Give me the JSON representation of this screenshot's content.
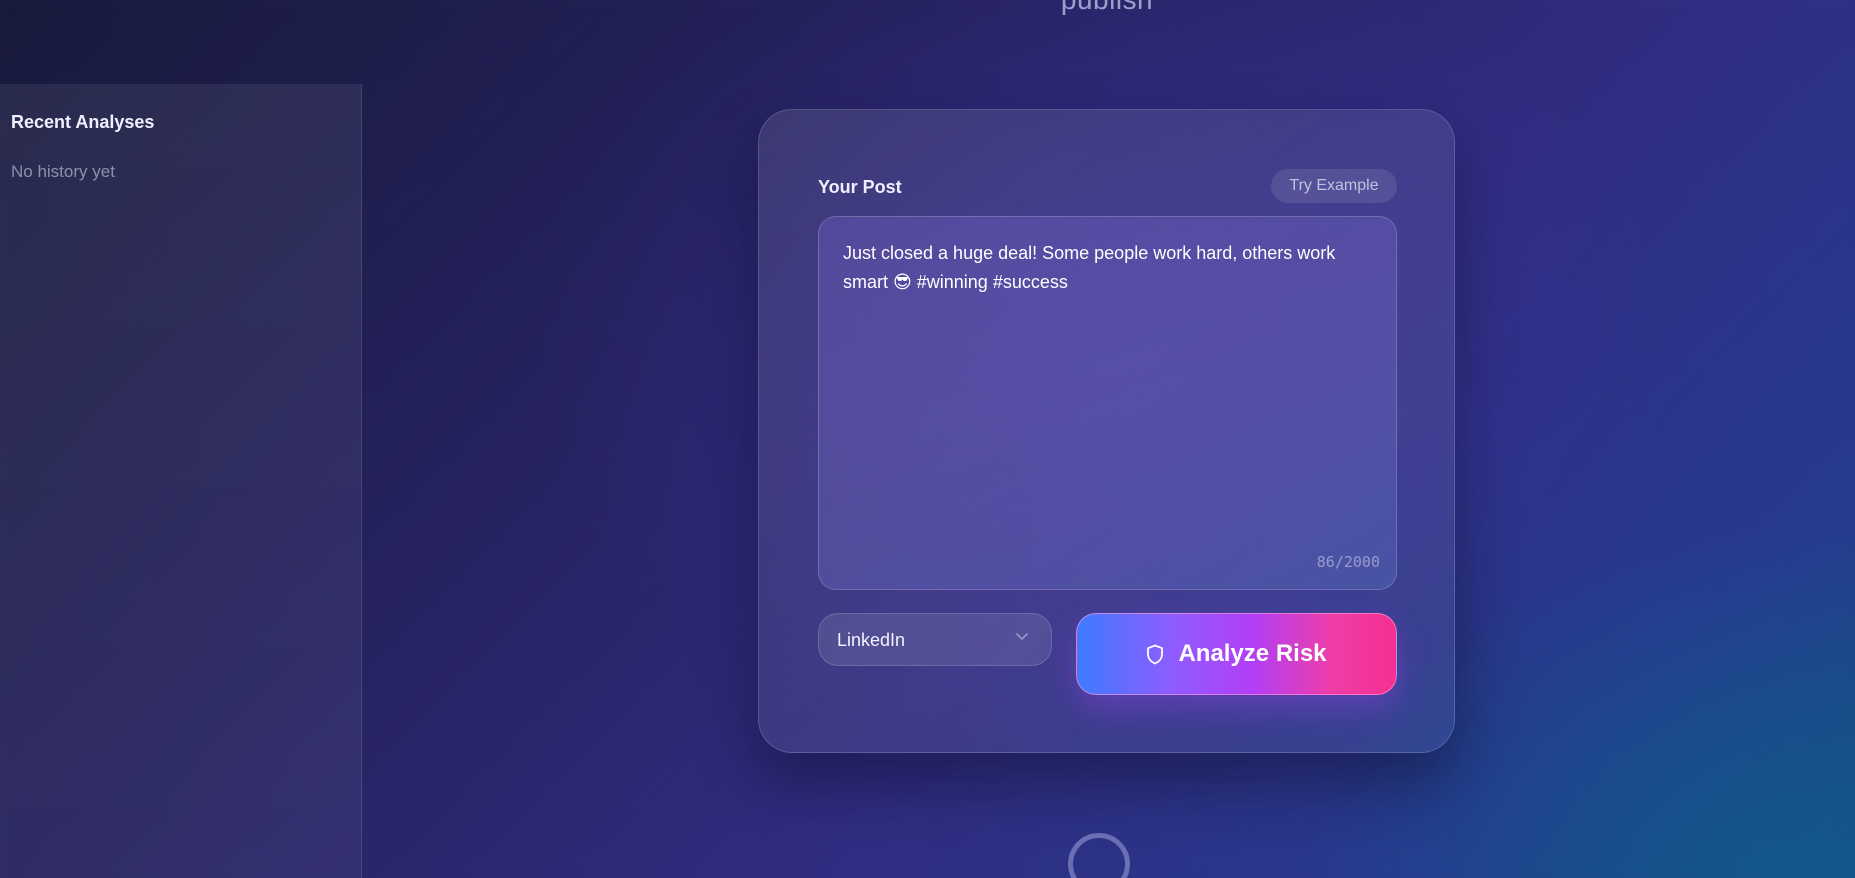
{
  "header": {
    "subtitle": "publish"
  },
  "sidebar": {
    "title": "Recent Analyses",
    "empty_text": "No history yet"
  },
  "composer": {
    "label": "Your Post",
    "try_example_label": "Try Example",
    "post_text": "Just closed a huge deal! Some people work hard, others work smart 😎 #winning #success",
    "char_count": "86/2000",
    "platform": {
      "selected": "LinkedIn",
      "icon": "chevron-down-icon"
    },
    "analyze_button": {
      "label": "Analyze Risk",
      "icon": "shield-icon"
    }
  },
  "status": {
    "loading_icon": "spinner-icon"
  },
  "colors": {
    "button_gradient_start": "#3d7bff",
    "button_gradient_mid": "#b23ef5",
    "button_gradient_end": "#f52f90"
  }
}
